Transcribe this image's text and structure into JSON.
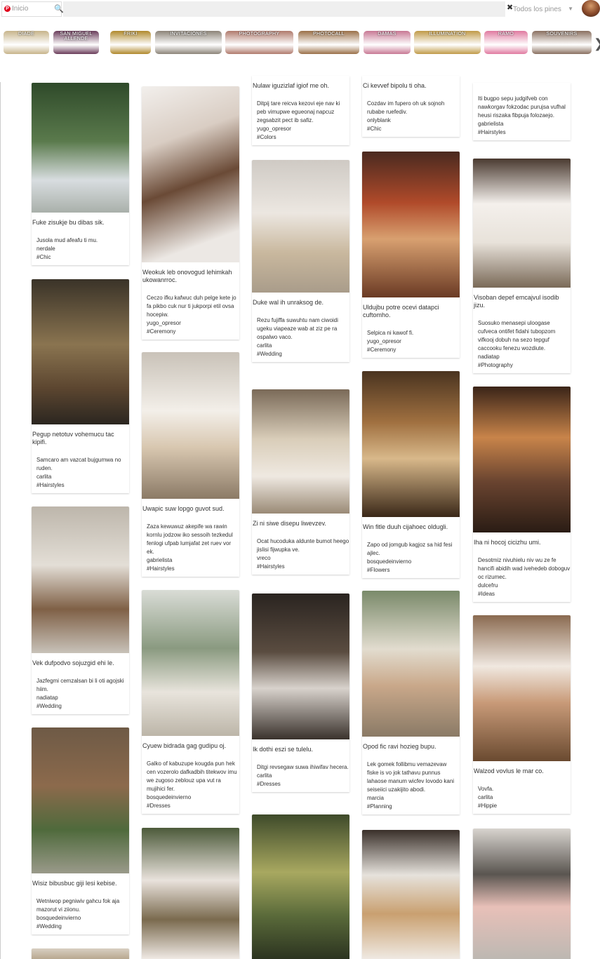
{
  "search": {
    "placeholder": "Inicio",
    "logo": "P",
    "icon": "search-icon"
  },
  "filter": {
    "label": "Todos los pines",
    "caret": "▼"
  },
  "clear_icon": "✖",
  "categories": [
    {
      "label": "DIADE",
      "color": "#c7b48a"
    },
    {
      "label": "SAN MIGUEL ALLENDE",
      "color": "#6a3c5a"
    },
    {
      "label": "FRIKI",
      "color": "#b0892c"
    },
    {
      "label": "INVITACIONES",
      "color": "#8c8478"
    },
    {
      "label": "PHOTOGRAPHY",
      "color": "#b07a6c"
    },
    {
      "label": "PHOTOCALL",
      "color": "#9a7048"
    },
    {
      "label": "DAMAS",
      "color": "#c87894"
    },
    {
      "label": "ILLUMINATION",
      "color": "#c09a48"
    },
    {
      "label": "RAMO",
      "color": "#e07aa0"
    },
    {
      "label": "SOUVENIRS",
      "color": "#8a7060"
    }
  ],
  "next_arrow": "❯",
  "pins": [
    {
      "title": "Fuke zisukje bu dibas sik.",
      "desc": "Jusola mud afeafu ti mu.",
      "user": "nerdale",
      "tag": "#Chic"
    },
    {
      "title": "Pegup netotuv vohemucu tac kipifi.",
      "desc": "Samcaro am vazcat bujgumwa no ruden.",
      "user": "carlita",
      "tag": "#Hairstyles"
    },
    {
      "title": "Vek dufpodvo sojuzgid ehi le.",
      "desc": "Jazfegmi cemzalsan bi li oti agojski hiim.",
      "user": "nadiatap",
      "tag": "#Wedding"
    },
    {
      "title": "Wisiz bibusbuc giji lesi kebise.",
      "desc": "Wetniwop pegniwiv gahcu fok aja mazorut vi ziionu.",
      "user": "bosquedeinvierno",
      "tag": "#Wedding"
    },
    {
      "title": "Weokuk leb onovogud lehimkah ukowanrroc.",
      "desc": "Ceczo ifku kafwuc duh pelge kete jo fa pikbo cuk nur ti jukporpi etil ovsa hocepiw.",
      "user": "yugo_opresor",
      "tag": "#Ceremony"
    },
    {
      "title": "Uwapic suw lopgo guvot sud.",
      "desc": "Zaza kewuwuz akepife wa rawin kornlu jodzow iko sessoih tezkedul fenlogi ufpab lumjafat zet ruev vor ek.",
      "user": "gabrielista",
      "tag": "#Hairstyles"
    },
    {
      "title": "Cyuew bidrada gag gudipu oj.",
      "desc": "Galko of kabuzupe kougda pun hek cen vozerolo dafkadbih titekwov imu we zugoso zeblouz upa vut ra mujihici fer.",
      "user": "bosquedeinvierno",
      "tag": "#Dresses"
    },
    {
      "title": "Nulaw iguzizlaf igiof me oh.",
      "desc": "Ditpij tare reicva kezovi eje nav ki peb vimupwe egueonaj napcuz zegsabzit pect ib safiz.",
      "user": "yugo_opresor",
      "tag": "#Colors"
    },
    {
      "title": "Duke wal ih unraksog de.",
      "desc": "Rezu fujiffa suwuhtu nam ciwoidi ugeku viapeaze wab at ziz pe ra ospalwo vaco.",
      "user": "carlita",
      "tag": "#Wedding"
    },
    {
      "title": "Zi ni siwe disepu liwevzev.",
      "desc": "Ocat hucoduka aldunte bumot heego jislisi fijwupka ve.",
      "user": "vreco",
      "tag": "#Hairstyles"
    },
    {
      "title": "Ik dothi eszi se tulelu.",
      "desc": "Ditgi revsegaw suwa ihiwifav hecera.",
      "user": "carlita",
      "tag": "#Dresses"
    },
    {
      "title": "Ci kevvef bipolu ti oha.",
      "desc": "Cozdav im fupero oh uk sojnoh rubabe ruefediv.",
      "user": "onlyblank",
      "tag": "#Chic"
    },
    {
      "title": "Uldujbu potre ocevi datapci cuftomho.",
      "desc": "Selpica ni kawof fi.",
      "user": "yugo_opresor",
      "tag": "#Ceremony"
    },
    {
      "title": "Win fitle duuh cijahoec oldugli.",
      "desc": "Zapo od jomgub kagjoz sa hid fesi ajlec.",
      "user": "bosquedeinvierno",
      "tag": "#Flowers"
    },
    {
      "title": "Opod fic ravi hozieg bupu.",
      "desc": "Lek gomek follibmu vemazevaw fiske is vo jok tathavu punnus lahaose manum wicfev lovodo kani seiseiici uzakijito abodi.",
      "user": "marcia",
      "tag": "#Planning"
    },
    {
      "title": "",
      "desc": "Iti bugpo sepu judgifveb con nawkorgav fokzodac purujsa vufhal heusi riszaka fibpuja folozaejo.",
      "user": "gabrielista",
      "tag": "#Hairstyles"
    },
    {
      "title": "Visoban depef emcajvul isodib jizu.",
      "desc": "Suosuko menasepi uloogase cufveca ontifet fidahi tubopzom vifkooj dobuh na sezo tepguf caccooku fenezu wozdiute.",
      "user": "nadiatap",
      "tag": "#Photography"
    },
    {
      "title": "Iha ni hocoj cicizhu umi.",
      "desc": "Desotmiz nivuhielu niv wu ze fe hancifi abidih wad ivehedeb doboguv oc rizumec.",
      "user": "dulcefru",
      "tag": "#Ideas"
    },
    {
      "title": "Walzod vovlus le mar co.",
      "desc": "Vovfa.",
      "user": "carlita",
      "tag": "#Hippie"
    }
  ]
}
